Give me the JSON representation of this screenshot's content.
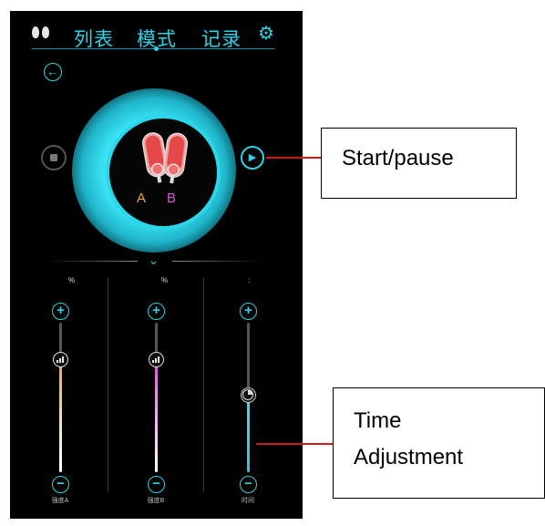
{
  "header": {
    "tabs": [
      {
        "label": "列表"
      },
      {
        "label": "模式"
      },
      {
        "label": "记录"
      }
    ],
    "active_tab": "模式"
  },
  "device": {
    "label_a": "A",
    "label_b": "B",
    "colors": {
      "accent": "#2fd2e6",
      "channel_a": "#e8a63a",
      "channel_b": "#d656d6"
    }
  },
  "sliders": [
    {
      "unit": "%",
      "label": "强度A",
      "level": 0.61,
      "color": "#e8a63a"
    },
    {
      "unit": "%",
      "label": "强度B",
      "level": 0.61,
      "color": "#d656d6"
    },
    {
      "unit": ":",
      "label": "时间",
      "level": 0.41,
      "color": "#2fd2e6"
    }
  ],
  "annotations": {
    "start_pause": "Start/pause",
    "time_adjustment_line1": "Time",
    "time_adjustment_line2": "Adjustment"
  },
  "icons": [
    "earbuds-icon",
    "gear-icon",
    "back-arrow-icon",
    "stop-icon",
    "play-icon",
    "chevron-down-icon",
    "plus-icon",
    "minus-icon",
    "signal-icon",
    "clock-icon"
  ]
}
